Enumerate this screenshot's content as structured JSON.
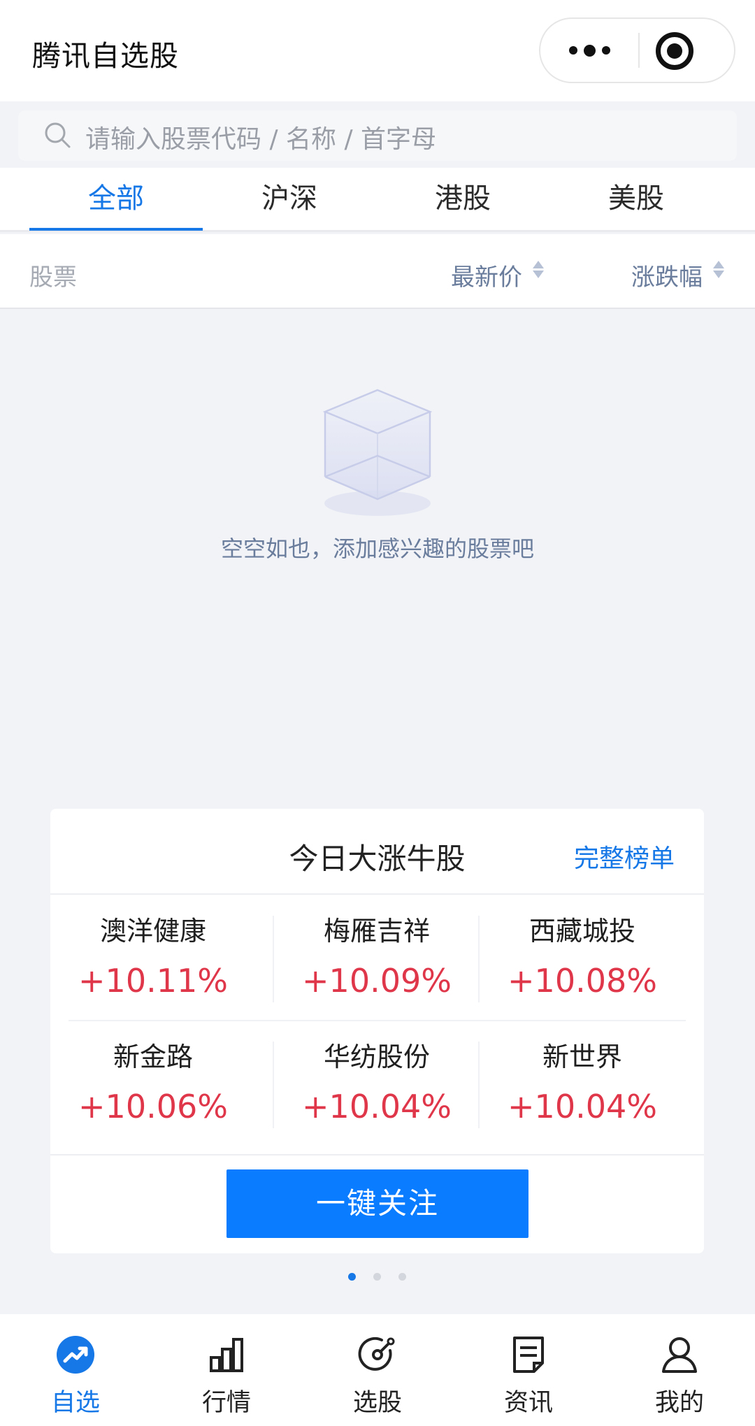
{
  "header": {
    "title": "腾讯自选股",
    "more_icon": "more-dots-icon",
    "close_icon": "target-icon"
  },
  "search": {
    "placeholder": "请输入股票代码 / 名称 / 首字母",
    "icon": "search-icon"
  },
  "tabs": [
    {
      "label": "全部",
      "active": true
    },
    {
      "label": "沪深",
      "active": false
    },
    {
      "label": "港股",
      "active": false
    },
    {
      "label": "美股",
      "active": false
    }
  ],
  "columns": {
    "stock": "股票",
    "price": "最新价",
    "change": "涨跌幅"
  },
  "empty_state": {
    "icon": "empty-box-icon",
    "text": "空空如也，添加感兴趣的股票吧"
  },
  "card": {
    "title": "今日大涨牛股",
    "link": "完整榜单",
    "stocks": [
      {
        "name": "澳洋健康",
        "change": "+10.11%"
      },
      {
        "name": "梅雁吉祥",
        "change": "+10.09%"
      },
      {
        "name": "西藏城投",
        "change": "+10.08%"
      },
      {
        "name": "新金路",
        "change": "+10.06%"
      },
      {
        "name": "华纺股份",
        "change": "+10.04%"
      },
      {
        "name": "新世界",
        "change": "+10.04%"
      }
    ],
    "button": "一键关注",
    "pages": 3,
    "current_page": 1
  },
  "tabbar": [
    {
      "label": "自选",
      "icon": "trend-icon",
      "active": true
    },
    {
      "label": "行情",
      "icon": "bar-chart-icon",
      "active": false
    },
    {
      "label": "选股",
      "icon": "target-pick-icon",
      "active": false
    },
    {
      "label": "资讯",
      "icon": "news-icon",
      "active": false
    },
    {
      "label": "我的",
      "icon": "user-icon",
      "active": false
    }
  ],
  "colors": {
    "accent": "#1677e6",
    "rise": "#e0364a",
    "button": "#0a7cff",
    "muted": "#6a7d9c"
  }
}
